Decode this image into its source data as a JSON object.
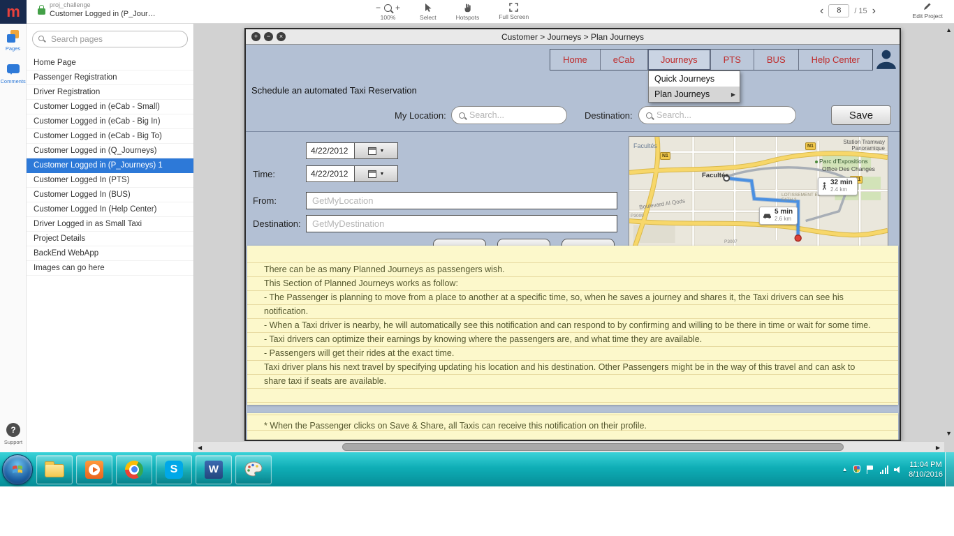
{
  "topbar": {
    "logo_glyph": "m",
    "project_name": "proj_challenge",
    "current_page_crumb": "Customer Logged in (P_Jour…",
    "zoom": {
      "minus": "−",
      "plus": "+",
      "level": "100%"
    },
    "tools": {
      "select": "Select",
      "hotspots": "Hotspots",
      "fullscreen": "Full Screen"
    },
    "pagination": {
      "prev": "‹",
      "current": "8",
      "total": "/ 15",
      "next": "›"
    },
    "edit_project": "Edit Project"
  },
  "rail": {
    "pages": "Pages",
    "comments": "Comments",
    "support": "Support"
  },
  "pages_panel": {
    "search_placeholder": "Search pages",
    "items": [
      {
        "label": "Home Page"
      },
      {
        "label": "Passenger Registration"
      },
      {
        "label": "Driver Registration"
      },
      {
        "label": "Customer Logged in (eCab - Small)"
      },
      {
        "label": "Customer Logged in (eCab - Big In)"
      },
      {
        "label": "Customer Logged in (eCab - Big To)"
      },
      {
        "label": "Customer Logged in (Q_Journeys)"
      },
      {
        "label": "Customer Logged in (P_Journeys) 1",
        "selected": true
      },
      {
        "label": "Customer Logged In (PTS)"
      },
      {
        "label": "Customer Logged In (BUS)"
      },
      {
        "label": "Customer Logged In (Help Center)"
      },
      {
        "label": "Driver Logged in as Small Taxi"
      },
      {
        "label": "Project Details"
      },
      {
        "label": "BackEnd WebApp"
      },
      {
        "label": "Images can go here"
      }
    ]
  },
  "mockup": {
    "window_controls": [
      "+",
      "−",
      "×"
    ],
    "window_title": "Customer > Journeys > Plan Journeys",
    "nav": [
      {
        "label": "Home"
      },
      {
        "label": "eCab"
      },
      {
        "label": "Journeys",
        "active": true
      },
      {
        "label": "PTS"
      },
      {
        "label": "BUS"
      },
      {
        "label": "Help Center"
      }
    ],
    "dropdown": [
      {
        "label": "Quick Journeys"
      },
      {
        "label": "Plan Journeys",
        "submenu": "▶",
        "active": true
      }
    ],
    "heading": "Schedule an automated Taxi Reservation",
    "my_location_label": "My Location:",
    "destination_label": "Destination:",
    "search_placeholder": "Search...",
    "save_button": "Save",
    "date_value": "4/22/2012",
    "time_label": "Time:",
    "time_value": "4/22/2012",
    "calendar_caret": "▼",
    "from_label": "From:",
    "from_placeholder": "GetMyLocation",
    "destination_placeholder": "GetMyDestination",
    "map": {
      "facultes_top": "Facultés",
      "station_line1": "Station Tramway",
      "station_line2": "Panoramique",
      "parc": "Parc d'Expositions",
      "office": "Office Des Changes",
      "facultes_center": "Facultés",
      "lotissement": "LOTISSEMENT EL FATH 2",
      "boulevard": "Boulevard Al Qods",
      "route_walk": {
        "time": "32 min",
        "dist": "2.4 km"
      },
      "route_drive": {
        "time": "5 min",
        "dist": "2.6 km"
      },
      "road_n1_a": "N1",
      "road_n1_b": "N1",
      "road_n11": "N11",
      "road_p3009": "P3009",
      "road_p3007": "P3007"
    },
    "notes": [
      {
        "text": "There can be as many Planned Journeys as passengers wish."
      },
      {
        "text": "This Section of Planned Journeys works as follow:"
      },
      {
        "text": "- The Passenger is planning to move from a place to another at a specific time, so, when he saves a journey and shares it, the Taxi drivers can see his notification."
      },
      {
        "text": "- When a Taxi driver is nearby, he will automatically see this notification and can respond to by confirming and willing to be there in time or wait for some time."
      },
      {
        "text": "- Taxi drivers can optimize their earnings by knowing where the passengers are, and what time they are available."
      },
      {
        "text": "- Passengers will get their rides at the exact time."
      },
      {
        "text": "Taxi driver plans his next travel by specifying updating his location and his destination. Other Passengers might be in the way of this travel and can ask to share taxi if seats are available."
      }
    ],
    "note_footer": "* When the Passenger clicks on Save & Share, all Taxis can receive this notification on their profile."
  },
  "taskbar": {
    "time": "11:04 PM",
    "date": "8/10/2016",
    "tray_expand": "▲",
    "skype_glyph": "S",
    "word_glyph": "W"
  },
  "scrollbars": {
    "up": "▲",
    "down": "▼",
    "left": "◀",
    "right": "▶"
  },
  "colors": {
    "accent_blue": "#2d79d8",
    "nav_red": "#bf2b2b",
    "taskbar_teal": "#0faeb6",
    "note_yellow": "#fcf8cb"
  }
}
